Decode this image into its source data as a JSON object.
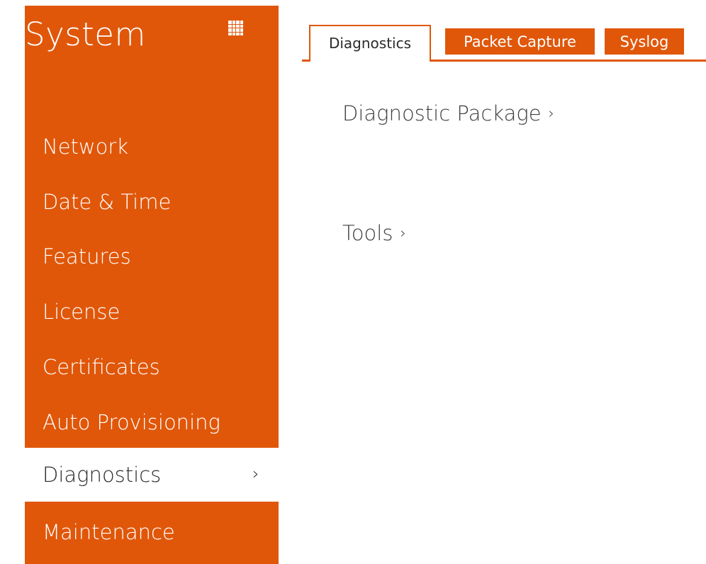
{
  "sidebar": {
    "title": "System",
    "menu_icon": "grid-menu-icon",
    "items": [
      {
        "label": "Network"
      },
      {
        "label": "Date & Time"
      },
      {
        "label": "Features"
      },
      {
        "label": "License"
      },
      {
        "label": "Certificates"
      },
      {
        "label": "Auto Provisioning"
      },
      {
        "label": "Diagnostics",
        "active": true
      },
      {
        "label": "Maintenance"
      }
    ],
    "active_chevron": "›"
  },
  "tabs": [
    {
      "label": "Diagnostics",
      "active": true
    },
    {
      "label": "Packet Capture"
    },
    {
      "label": "Syslog"
    }
  ],
  "main": {
    "sections": [
      {
        "label": "Diagnostic Package",
        "chevron": "›"
      },
      {
        "label": "Tools",
        "chevron": "›"
      }
    ]
  },
  "colors": {
    "accent": "#e0570a",
    "text": "#404040",
    "background": "#ffffff"
  }
}
